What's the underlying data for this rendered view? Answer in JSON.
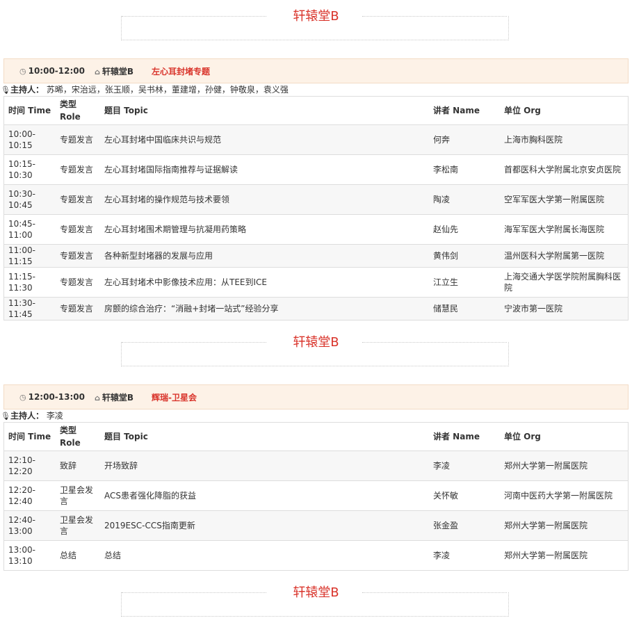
{
  "room_header": "轩辕堂B",
  "sessions": [
    {
      "time": "10:00-12:00",
      "room": "轩辕堂B",
      "topic": "左心耳封堵专题",
      "chair_label": "主持人：",
      "chairs": "苏晞，宋治远，张玉顺，吴书林，董建增，孙健，钟敬泉，袁义强",
      "headers": {
        "time": "时间 Time",
        "role": "类型 Role",
        "topic": "题目 Topic",
        "speaker": "讲者 Name",
        "org": "单位 Org"
      },
      "rows": [
        {
          "time": "10:00-10:15",
          "role": "专题发言",
          "topic": "左心耳封堵中国临床共识与规范",
          "speaker": "何奔",
          "org": "上海市胸科医院"
        },
        {
          "time": "10:15-10:30",
          "role": "专题发言",
          "topic": "左心耳封堵国际指南推荐与证据解读",
          "speaker": "李松南",
          "org": "首都医科大学附属北京安贞医院"
        },
        {
          "time": "10:30-10:45",
          "role": "专题发言",
          "topic": "左心耳封堵的操作规范与技术要领",
          "speaker": "陶凌",
          "org": "空军军医大学第一附属医院"
        },
        {
          "time": "10:45-11:00",
          "role": "专题发言",
          "topic": "左心耳封堵围术期管理与抗凝用药策略",
          "speaker": "赵仙先",
          "org": "海军军医大学附属长海医院"
        },
        {
          "time": "11:00-11:15",
          "role": "专题发言",
          "topic": "各种新型封堵器的发展与应用",
          "speaker": "黄伟剑",
          "org": "温州医科大学附属第一医院"
        },
        {
          "time": "11:15-11:30",
          "role": "专题发言",
          "topic": "左心耳封堵术中影像技术应用：从TEE到ICE",
          "speaker": "江立生",
          "org": "上海交通大学医学院附属胸科医院"
        },
        {
          "time": "11:30-11:45",
          "role": "专题发言",
          "topic": "房颤的综合治疗：“消融+封堵一站式”经验分享",
          "speaker": "储慧民",
          "org": "宁波市第一医院"
        }
      ]
    },
    {
      "time": "12:00-13:00",
      "room": "轩辕堂B",
      "topic": "辉瑞-卫星会",
      "chair_label": "主持人：",
      "chairs": "李凌",
      "headers": {
        "time": "时间 Time",
        "role": "类型 Role",
        "topic": "题目 Topic",
        "speaker": "讲者 Name",
        "org": "单位 Org"
      },
      "rows": [
        {
          "time": "12:10-12:20",
          "role": "致辞",
          "topic": "开场致辞",
          "speaker": "李凌",
          "org": "郑州大学第一附属医院"
        },
        {
          "time": "12:20-12:40",
          "role": "卫星会发言",
          "topic": "ACS患者强化降脂的获益",
          "speaker": "关怀敏",
          "org": "河南中医药大学第一附属医院"
        },
        {
          "time": "12:40-13:00",
          "role": "卫星会发言",
          "topic": "2019ESC-CCS指南更新",
          "speaker": "张金盈",
          "org": "郑州大学第一附属医院"
        },
        {
          "time": "13:00-13:10",
          "role": "总结",
          "topic": "总结",
          "speaker": "李凌",
          "org": "郑州大学第一附属医院"
        }
      ]
    }
  ],
  "icons": {
    "clock": "clock-icon",
    "home": "home-icon",
    "mic": "microphone-icon"
  }
}
